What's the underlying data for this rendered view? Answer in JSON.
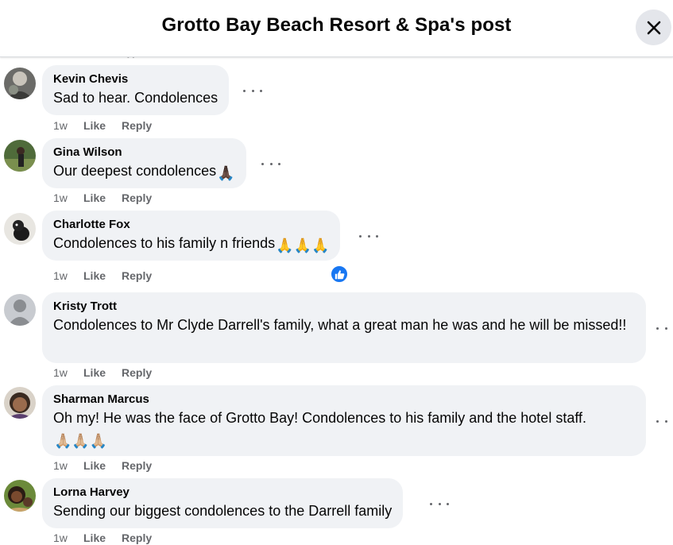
{
  "header": {
    "title": "Grotto Bay Beach Resort & Spa's post"
  },
  "partial_text": "yy",
  "comments": [
    {
      "author": "Kevin Chevis",
      "text": "Sad to hear. Condolences",
      "time": "1w",
      "like": "Like",
      "reply": "Reply",
      "emoji": ""
    },
    {
      "author": "Gina Wilson",
      "text": "Our deepest condolences",
      "time": "1w",
      "like": "Like",
      "reply": "Reply",
      "emoji": "🙏🏿"
    },
    {
      "author": "Charlotte Fox",
      "text": "Condolences to his family n friends",
      "time": "1w",
      "like": "Like",
      "reply": "Reply",
      "emoji": "🙏🙏🙏"
    },
    {
      "author": "Kristy Trott",
      "text": "Condolences to Mr Clyde Darrell's family, what a great man he was and he will be missed!!",
      "time": "1w",
      "like": "Like",
      "reply": "Reply",
      "emoji": ""
    },
    {
      "author": "Sharman Marcus",
      "text": "Oh my! He was the face of Grotto Bay! Condolences to his family and the hotel staff.",
      "time": "1w",
      "like": "Like",
      "reply": "Reply",
      "emoji": "🙏🏼🙏🏼🙏🏼"
    },
    {
      "author": "Lorna Harvey",
      "text": "Sending our biggest condolences to the Darrell family",
      "time": "1w",
      "like": "Like",
      "reply": "Reply",
      "emoji": ""
    }
  ],
  "colors": {
    "accent": "#1877f2",
    "bubble": "#f0f2f5",
    "secondary_text": "#65676b"
  },
  "icons": {
    "close": "close-icon",
    "more": "more-options-icon",
    "reaction": "like-reaction-icon"
  }
}
